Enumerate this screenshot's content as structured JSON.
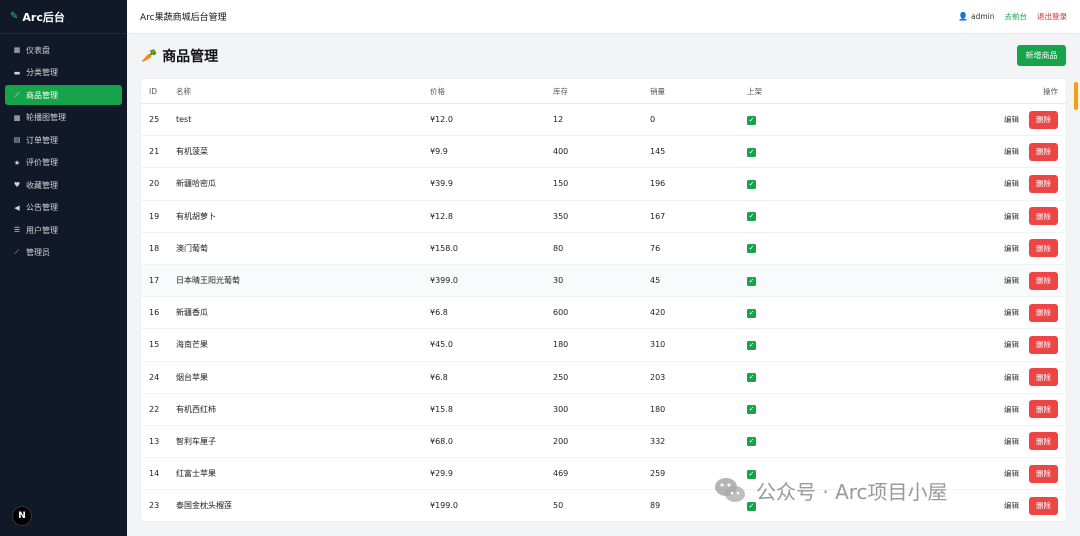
{
  "sidebar": {
    "brand": "Arc后台",
    "items": [
      {
        "label": "仪表盘",
        "icon": "dashboard-icon",
        "glyph": "▦",
        "active": false
      },
      {
        "label": "分类管理",
        "icon": "folder-icon",
        "glyph": "▬",
        "active": false
      },
      {
        "label": "商品管理",
        "icon": "carrot-icon",
        "glyph": "⟋",
        "active": true
      },
      {
        "label": "轮播图管理",
        "icon": "image-icon",
        "glyph": "▩",
        "active": false
      },
      {
        "label": "订单管理",
        "icon": "order-icon",
        "glyph": "▤",
        "active": false
      },
      {
        "label": "评价管理",
        "icon": "star-icon",
        "glyph": "★",
        "active": false
      },
      {
        "label": "收藏管理",
        "icon": "heart-icon",
        "glyph": "♥",
        "active": false
      },
      {
        "label": "公告管理",
        "icon": "megaphone-icon",
        "glyph": "◀",
        "active": false
      },
      {
        "label": "用户管理",
        "icon": "users-icon",
        "glyph": "☰",
        "active": false
      },
      {
        "label": "管理员",
        "icon": "pen-icon",
        "glyph": "⟋",
        "active": false
      }
    ],
    "footer_logo": "N"
  },
  "header": {
    "title": "Arc果蔬商城后台管理",
    "user": "admin",
    "front_link": "去前台",
    "logout_link": "退出登录"
  },
  "page": {
    "title": "商品管理",
    "add_button": "新增商品"
  },
  "table": {
    "columns": {
      "id": "ID",
      "name": "名称",
      "price": "价格",
      "stock": "库存",
      "sales": "销量",
      "on_shelf": "上架",
      "ops": "操作"
    },
    "edit_label": "编辑",
    "delete_label": "删除",
    "rows": [
      {
        "id": "25",
        "name": "test",
        "price": "¥12.0",
        "stock": "12",
        "sales": "0"
      },
      {
        "id": "21",
        "name": "有机菠菜",
        "price": "¥9.9",
        "stock": "400",
        "sales": "145"
      },
      {
        "id": "20",
        "name": "新疆哈密瓜",
        "price": "¥39.9",
        "stock": "150",
        "sales": "196"
      },
      {
        "id": "19",
        "name": "有机胡萝卜",
        "price": "¥12.8",
        "stock": "350",
        "sales": "167"
      },
      {
        "id": "18",
        "name": "澳门葡萄",
        "price": "¥158.0",
        "stock": "80",
        "sales": "76"
      },
      {
        "id": "17",
        "name": "日本晴王阳光葡萄",
        "price": "¥399.0",
        "stock": "30",
        "sales": "45"
      },
      {
        "id": "16",
        "name": "新疆香瓜",
        "price": "¥6.8",
        "stock": "600",
        "sales": "420"
      },
      {
        "id": "15",
        "name": "海南芒果",
        "price": "¥45.0",
        "stock": "180",
        "sales": "310"
      },
      {
        "id": "24",
        "name": "烟台苹果",
        "price": "¥6.8",
        "stock": "250",
        "sales": "203"
      },
      {
        "id": "22",
        "name": "有机西红柿",
        "price": "¥15.8",
        "stock": "300",
        "sales": "180"
      },
      {
        "id": "13",
        "name": "智利车厘子",
        "price": "¥68.0",
        "stock": "200",
        "sales": "332"
      },
      {
        "id": "14",
        "name": "红富士苹果",
        "price": "¥29.9",
        "stock": "469",
        "sales": "259"
      },
      {
        "id": "23",
        "name": "泰国金枕头榴莲",
        "price": "¥199.0",
        "stock": "50",
        "sales": "89"
      }
    ]
  },
  "watermark": "公众号 · Arc项目小屋"
}
